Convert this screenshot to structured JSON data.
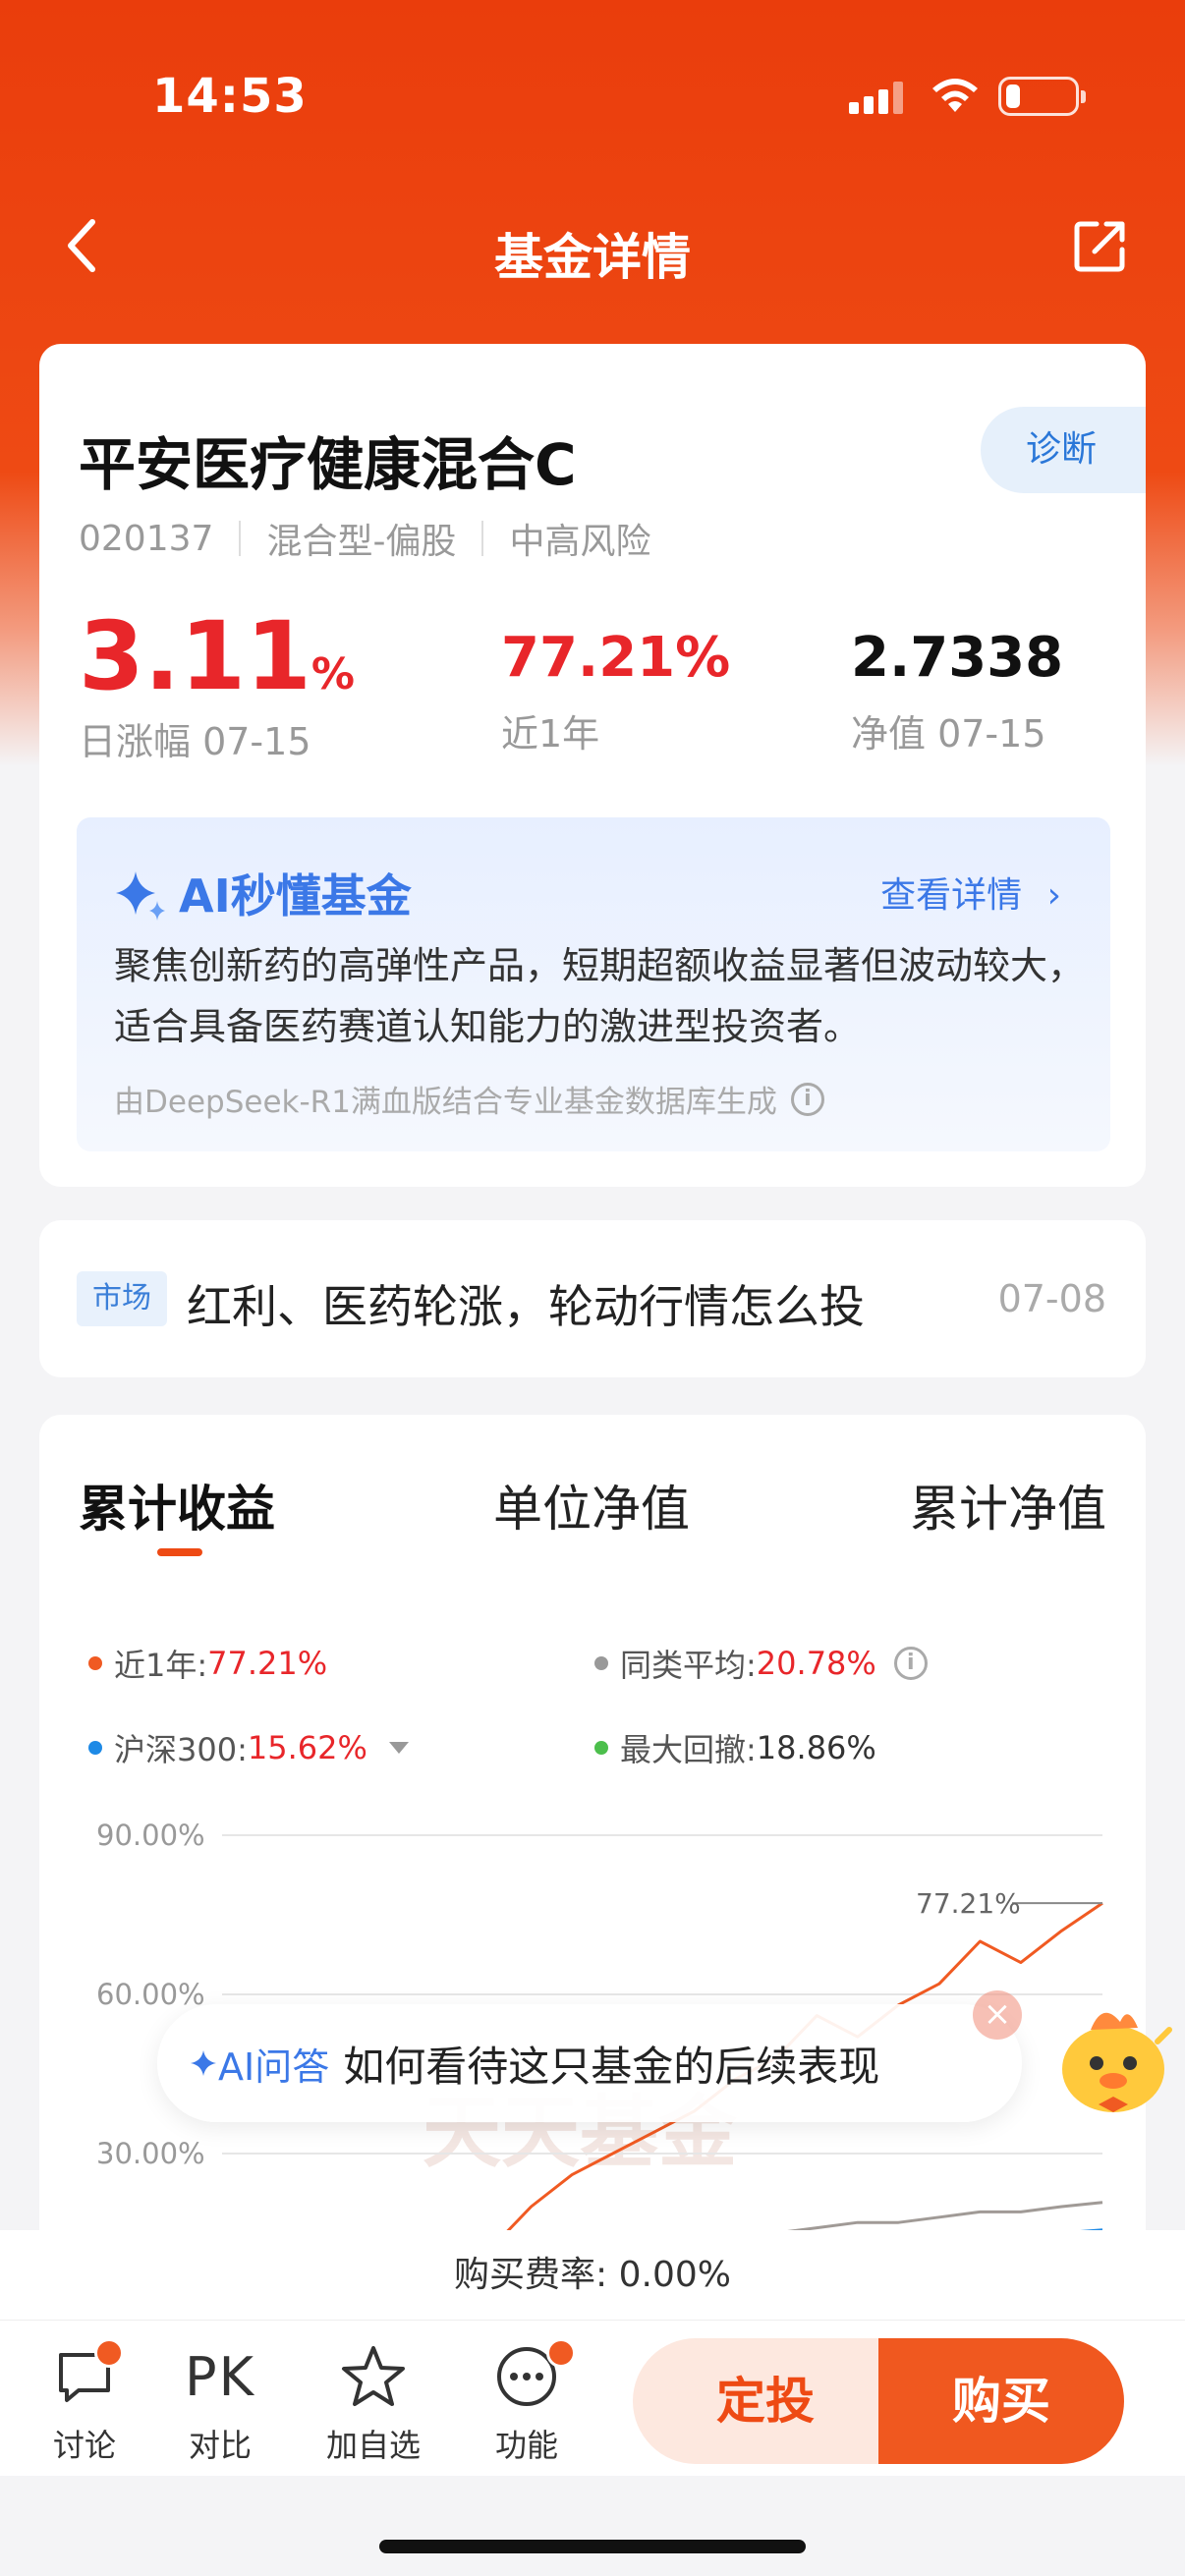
{
  "status": {
    "time": "14:53"
  },
  "nav": {
    "title": "基金详情"
  },
  "fund": {
    "name": "平安医疗健康混合C",
    "code": "020137",
    "type": "混合型-偏股",
    "risk": "中高风险",
    "diagnose_label": "诊断",
    "daily_change": "3.11",
    "daily_change_unit": "%",
    "daily_change_label": "日涨幅 07-15",
    "year_return": "77.21%",
    "year_return_label": "近1年",
    "nav_value": "2.7338",
    "nav_label": "净值 07-15"
  },
  "ai": {
    "title": "AI秒懂基金",
    "more": "查看详情",
    "description": "聚焦创新药的高弹性产品，短期超额收益显著但波动较大，适合具备医药赛道认知能力的激进型投资者。",
    "source": "由DeepSeek-R1满血版结合专业基金数据库生成"
  },
  "news": {
    "tag": "市场",
    "title": "红利、医药轮涨，轮动行情怎么投",
    "date": "07-08"
  },
  "chart_tabs": [
    "累计收益",
    "单位净值",
    "累计净值"
  ],
  "legend": [
    {
      "label": "近1年:",
      "value": "77.21%",
      "color": "#f05a22"
    },
    {
      "label": "同类平均:",
      "value": "20.78%",
      "color": "#999999"
    },
    {
      "label": "沪深300:",
      "value": "15.62%",
      "color": "#1e8ae6"
    },
    {
      "label": "最大回撤:",
      "value": "18.86%",
      "color": "#4cbf4c"
    }
  ],
  "chart_data": {
    "type": "line",
    "y_ticks": [
      "90.00%",
      "60.00%",
      "30.00%"
    ],
    "end_label": "77.21%",
    "watermark": "天天基金",
    "series": [
      {
        "name": "近1年",
        "values": [
          5,
          8,
          12,
          20,
          26,
          30,
          34,
          38,
          44,
          48,
          56,
          52,
          58,
          62,
          70,
          66,
          72,
          77.21
        ]
      },
      {
        "name": "同类平均",
        "values": [
          2,
          3,
          5,
          8,
          10,
          11,
          12,
          13,
          14,
          15,
          16,
          17,
          17,
          18,
          19,
          19,
          20,
          20.78
        ]
      },
      {
        "name": "沪深300",
        "values": [
          1,
          2,
          3,
          5,
          6,
          7,
          8,
          9,
          10,
          11,
          12,
          12,
          13,
          14,
          14,
          15,
          15,
          15.62
        ]
      }
    ]
  },
  "qa": {
    "tag": "AI问答",
    "text": "如何看待这只基金的后续表现"
  },
  "fee": "购买费率: 0.00%",
  "bottom": {
    "discuss": "讨论",
    "pk_icon": "PK",
    "compare": "对比",
    "watch": "加自选",
    "function": "功能",
    "dingtou": "定投",
    "buy": "购买"
  },
  "colors": {
    "brand": "#ee4a14",
    "up": "#e8262a",
    "ai": "#3b78e7"
  }
}
